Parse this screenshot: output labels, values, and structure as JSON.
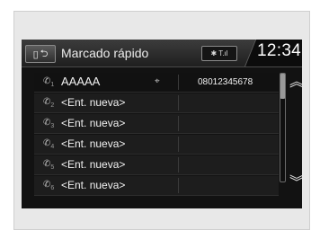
{
  "header": {
    "title": "Marcado rápido",
    "status_text": "✱ T.ıl",
    "clock": "12:34"
  },
  "speed_dials": [
    {
      "index": "1",
      "name": "AAAAA",
      "number": "08012345678"
    },
    {
      "index": "2",
      "name": "<Ent. nueva>",
      "number": ""
    },
    {
      "index": "3",
      "name": "<Ent. nueva>",
      "number": ""
    },
    {
      "index": "4",
      "name": "<Ent. nueva>",
      "number": ""
    },
    {
      "index": "5",
      "name": "<Ent. nueva>",
      "number": ""
    },
    {
      "index": "6",
      "name": "<Ent. nueva>",
      "number": ""
    }
  ],
  "scrollbar": {
    "position_fraction": 0.0
  },
  "icons": {
    "back": "back-arrow-icon",
    "phone": "phone-icon",
    "voice_tag": "voice-tag-icon",
    "scroll_up": "scroll-up-icon",
    "scroll_down": "scroll-down-icon"
  }
}
